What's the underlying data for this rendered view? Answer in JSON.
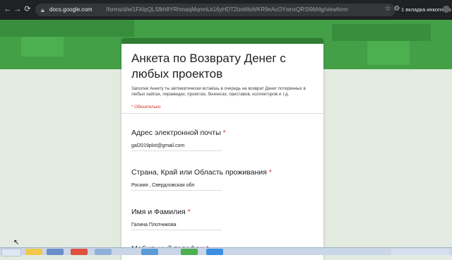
{
  "browser": {
    "url_domain": "docs.google.com",
    "url_path": "/forms/d/e/1FAIpQLSfkh8YRhmaqMqnmLk16yHDT2izeMsWKR9eAcOYwnxQRSI9bMg/viewform",
    "incognito_label": "1 вкладка инкогнито"
  },
  "form": {
    "title": "Анкета по Возврату Денег с любых проектов",
    "description": "Заполни Анкету ты автоматически встаёшь в очередь на возврат Денег потерянных в любых хайпах, пирамидах, проектах, бизнесах, приставов, коллекторов и т.д.",
    "required_note": "* Обязательно",
    "required_star": "*",
    "questions": [
      {
        "label": "Адрес электронной почты",
        "answer": "gal2019plot@gmail.com"
      },
      {
        "label": "Страна, Край или Область проживания",
        "answer": "Росиия , Свердловская обл"
      },
      {
        "label": "Имя и Фамилия",
        "answer": "Галина Плотникова"
      },
      {
        "label": "Мобильный телефон",
        "answer": ""
      }
    ]
  },
  "colors": {
    "banner": "#43a047",
    "accent": "#2e7d32",
    "required": "#d93025"
  },
  "icons": [
    "back-icon",
    "forward-icon",
    "reload-icon",
    "lock-icon",
    "bookmark-star-icon",
    "extension-icon",
    "incognito-icon"
  ]
}
